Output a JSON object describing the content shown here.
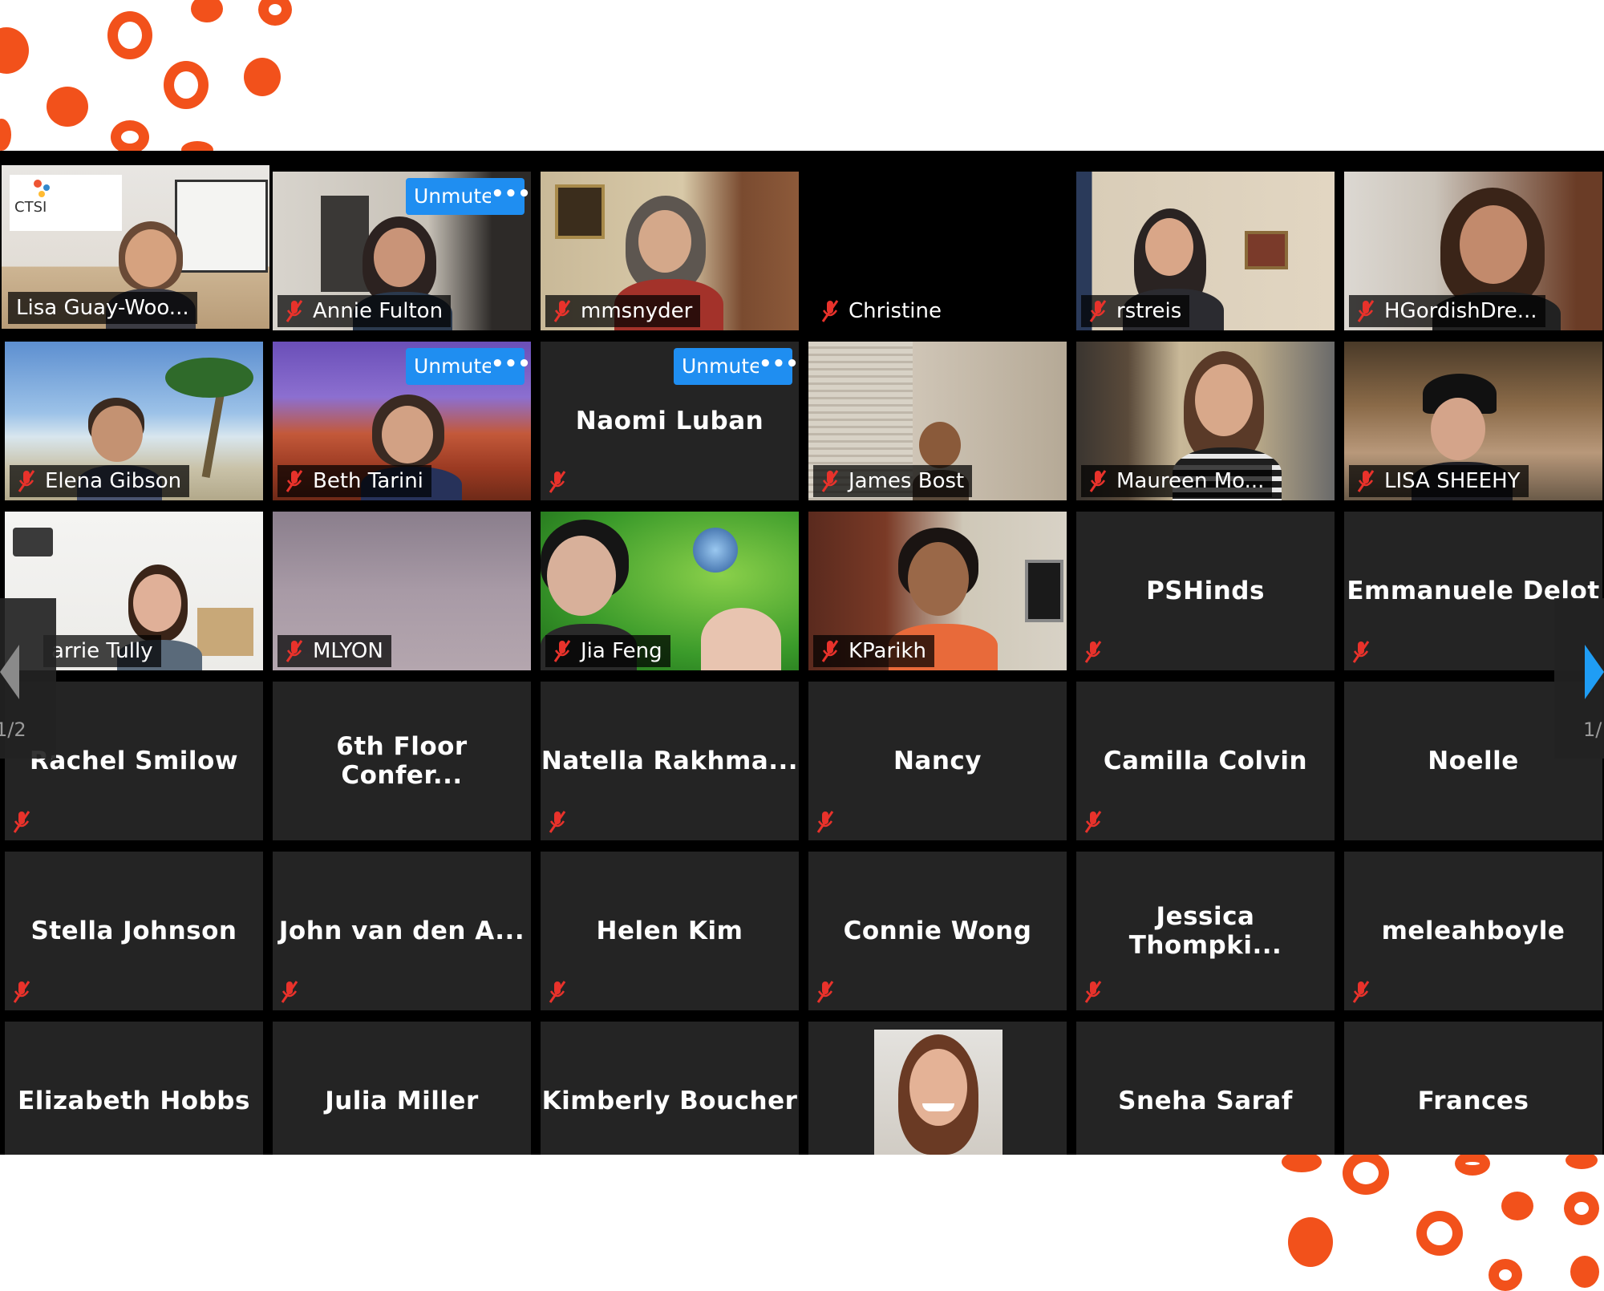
{
  "participants": [
    {
      "name": "Lisa Guay-Woo...",
      "video": true,
      "active": true,
      "muted": false
    },
    {
      "name": "Annie Fulton",
      "video": true,
      "muted": true,
      "hover_buttons": true
    },
    {
      "name": "mmsnyder",
      "video": true,
      "muted": true
    },
    {
      "name": "Christine",
      "video": false,
      "label_only": true,
      "muted": true
    },
    {
      "name": "rstreis",
      "video": true,
      "muted": true
    },
    {
      "name": "HGordishDre...",
      "video": true,
      "muted": true
    },
    {
      "name": "Elena Gibson",
      "video": true,
      "muted": true
    },
    {
      "name": "Beth Tarini",
      "video": true,
      "muted": true,
      "hover_buttons": true
    },
    {
      "name": "Naomi Luban",
      "video": false,
      "muted": true,
      "hover_buttons": true
    },
    {
      "name": "James Bost",
      "video": true,
      "muted": true
    },
    {
      "name": "Maureen Mo...",
      "video": true,
      "muted": true
    },
    {
      "name": "LISA SHEEHY",
      "video": true,
      "muted": true
    },
    {
      "name": "arrie Tully",
      "video": true,
      "muted": false
    },
    {
      "name": "MLYON",
      "video": true,
      "muted": true
    },
    {
      "name": "Jia Feng",
      "video": true,
      "muted": true
    },
    {
      "name": "KParikh",
      "video": true,
      "muted": true
    },
    {
      "name": "PSHinds",
      "video": false,
      "muted": true
    },
    {
      "name": "Emmanuele Delot",
      "video": false,
      "muted": true
    },
    {
      "name": "Rachel Smilow",
      "video": false,
      "muted": true
    },
    {
      "name": "6th Floor Confer...",
      "video": false,
      "muted": false
    },
    {
      "name": "Natella Rakhma...",
      "video": false,
      "muted": true
    },
    {
      "name": "Nancy",
      "video": false,
      "muted": true
    },
    {
      "name": "Camilla Colvin",
      "video": false,
      "muted": true
    },
    {
      "name": "Noelle",
      "video": false,
      "muted": false
    },
    {
      "name": "Stella Johnson",
      "video": false,
      "muted": true
    },
    {
      "name": "John van den A...",
      "video": false,
      "muted": true
    },
    {
      "name": "Helen Kim",
      "video": false,
      "muted": true
    },
    {
      "name": "Connie Wong",
      "video": false,
      "muted": true
    },
    {
      "name": "Jessica Thompki...",
      "video": false,
      "muted": true
    },
    {
      "name": "meleahboyle",
      "video": false,
      "muted": true
    },
    {
      "name": "Elizabeth Hobbs",
      "video": false,
      "muted": false
    },
    {
      "name": "Julia Miller",
      "video": false,
      "muted": false
    },
    {
      "name": "Kimberly Boucher",
      "video": false,
      "muted": false
    },
    {
      "name": "",
      "video": true,
      "photo": true,
      "muted": false
    },
    {
      "name": "Sneha Saraf",
      "video": false,
      "muted": false
    },
    {
      "name": "Frances",
      "video": false,
      "muted": false
    }
  ],
  "controls": {
    "unmute_label": "Unmute",
    "more_label": "•••"
  },
  "pagination": {
    "left_indicator": "1/2",
    "right_indicator": "1/"
  },
  "logo": {
    "text": "CTSI"
  },
  "colors": {
    "accent": "#f2511b",
    "active_speaker": "#b7e04a",
    "button": "#1f8ef1",
    "tile_bg": "#242424",
    "muted_icon": "#e8322b"
  },
  "icons": {
    "mic": "muted-mic-icon",
    "more": "more-options-icon",
    "prev": "chevron-left-icon",
    "next": "chevron-right-icon"
  }
}
